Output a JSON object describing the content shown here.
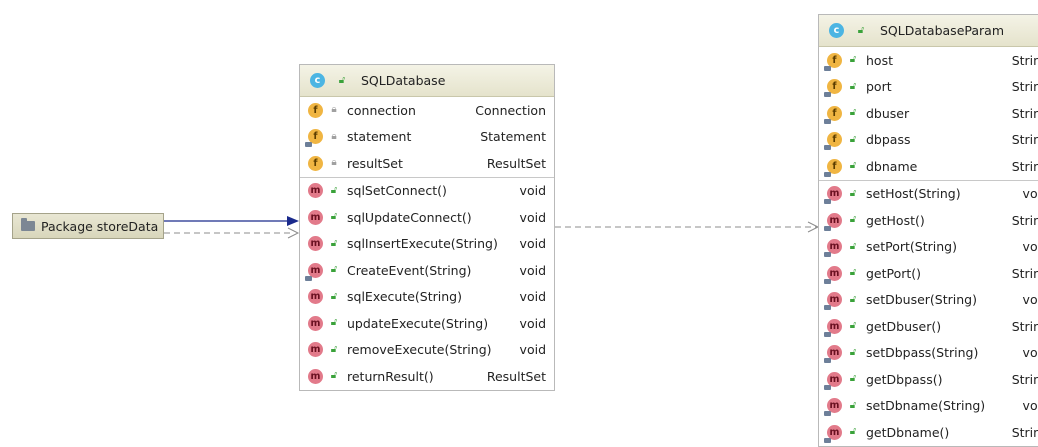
{
  "package_node": {
    "label": "Package storeData",
    "icon": "folder-icon"
  },
  "classes": [
    {
      "id": "sqldatabase",
      "kind_badge": "c",
      "name": "SQLDatabase",
      "fields": [
        {
          "badge": "f",
          "modifier": false,
          "visibility": "private",
          "name": "connection",
          "type": "Connection"
        },
        {
          "badge": "f",
          "modifier": true,
          "visibility": "private",
          "name": "statement",
          "type": "Statement"
        },
        {
          "badge": "f",
          "modifier": false,
          "visibility": "private",
          "name": "resultSet",
          "type": "ResultSet"
        }
      ],
      "methods": [
        {
          "badge": "m",
          "modifier": false,
          "visibility": "public",
          "name": "sqlSetConnect()",
          "type": "void"
        },
        {
          "badge": "m",
          "modifier": false,
          "visibility": "public",
          "name": "sqlUpdateConnect()",
          "type": "void"
        },
        {
          "badge": "m",
          "modifier": false,
          "visibility": "public",
          "name": "sqlInsertExecute(String)",
          "type": "void"
        },
        {
          "badge": "m",
          "modifier": true,
          "visibility": "public",
          "name": "CreateEvent(String)",
          "type": "void"
        },
        {
          "badge": "m",
          "modifier": false,
          "visibility": "public",
          "name": "sqlExecute(String)",
          "type": "void"
        },
        {
          "badge": "m",
          "modifier": false,
          "visibility": "public",
          "name": "updateExecute(String)",
          "type": "void"
        },
        {
          "badge": "m",
          "modifier": false,
          "visibility": "public",
          "name": "removeExecute(String)",
          "type": "void"
        },
        {
          "badge": "m",
          "modifier": false,
          "visibility": "public",
          "name": "returnResult()",
          "type": "ResultSet"
        }
      ]
    },
    {
      "id": "sqldatabaseparam",
      "kind_badge": "c",
      "name": "SQLDatabaseParam",
      "fields": [
        {
          "badge": "f",
          "modifier": true,
          "visibility": "public",
          "name": "host",
          "type": "String"
        },
        {
          "badge": "f",
          "modifier": true,
          "visibility": "public",
          "name": "port",
          "type": "String"
        },
        {
          "badge": "f",
          "modifier": true,
          "visibility": "public",
          "name": "dbuser",
          "type": "String"
        },
        {
          "badge": "f",
          "modifier": true,
          "visibility": "public",
          "name": "dbpass",
          "type": "String"
        },
        {
          "badge": "f",
          "modifier": true,
          "visibility": "public",
          "name": "dbname",
          "type": "String"
        }
      ],
      "methods": [
        {
          "badge": "m",
          "modifier": true,
          "visibility": "public",
          "name": "setHost(String)",
          "type": "void"
        },
        {
          "badge": "m",
          "modifier": true,
          "visibility": "public",
          "name": "getHost()",
          "type": "String"
        },
        {
          "badge": "m",
          "modifier": true,
          "visibility": "public",
          "name": "setPort(String)",
          "type": "void"
        },
        {
          "badge": "m",
          "modifier": true,
          "visibility": "public",
          "name": "getPort()",
          "type": "String"
        },
        {
          "badge": "m",
          "modifier": true,
          "visibility": "public",
          "name": "setDbuser(String)",
          "type": "void"
        },
        {
          "badge": "m",
          "modifier": true,
          "visibility": "public",
          "name": "getDbuser()",
          "type": "String"
        },
        {
          "badge": "m",
          "modifier": true,
          "visibility": "public",
          "name": "setDbpass(String)",
          "type": "void"
        },
        {
          "badge": "m",
          "modifier": true,
          "visibility": "public",
          "name": "getDbpass()",
          "type": "String"
        },
        {
          "badge": "m",
          "modifier": true,
          "visibility": "public",
          "name": "setDbname(String)",
          "type": "void"
        },
        {
          "badge": "m",
          "modifier": true,
          "visibility": "public",
          "name": "getDbname()",
          "type": "String"
        }
      ]
    }
  ],
  "edges": [
    {
      "from": "package_node",
      "to": "sqldatabase",
      "style": "solid",
      "color": "#1a2a8c",
      "arrow": "filled"
    },
    {
      "from": "package_node",
      "to": "sqldatabase",
      "style": "dashed",
      "color": "#8c8c8c",
      "arrow": "open"
    },
    {
      "from": "sqldatabase",
      "to": "sqldatabaseparam",
      "style": "dashed",
      "color": "#8c8c8c",
      "arrow": "open"
    }
  ]
}
